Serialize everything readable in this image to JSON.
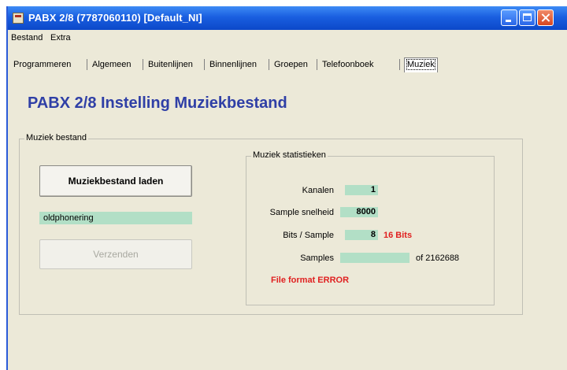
{
  "window": {
    "title": "PABX 2/8 (7787060110) [Default_NI]"
  },
  "menubar": {
    "items": [
      "Bestand",
      "Extra"
    ]
  },
  "tabs": [
    "Programmeren",
    "Algemeen",
    "Buitenlijnen",
    "Binnenlijnen",
    "Groepen",
    "Telefoonboek",
    "Muziek"
  ],
  "active_tab": "Muziek",
  "page": {
    "heading": "PABX 2/8 Instelling Muziekbestand"
  },
  "music_file": {
    "group_title": "Muziek bestand",
    "load_button": "Muziekbestand laden",
    "filename": "oldphonering",
    "send_button": "Verzenden"
  },
  "stats": {
    "group_title": "Muziek statistieken",
    "channels_label": "Kanalen",
    "channels_value": "1",
    "sample_rate_label": "Sample snelheid",
    "sample_rate_value": "8000",
    "bits_label": "Bits / Sample",
    "bits_value": "8",
    "bits_note": "16 Bits",
    "samples_label": "Samples",
    "samples_value": "",
    "samples_total": "of 2162688",
    "error_text": "File format ERROR"
  },
  "colors": {
    "accent_heading": "#2f3fa6",
    "field_bg": "#b2dfc6",
    "error": "#e02020",
    "titlebar": "#1a5fe0"
  }
}
